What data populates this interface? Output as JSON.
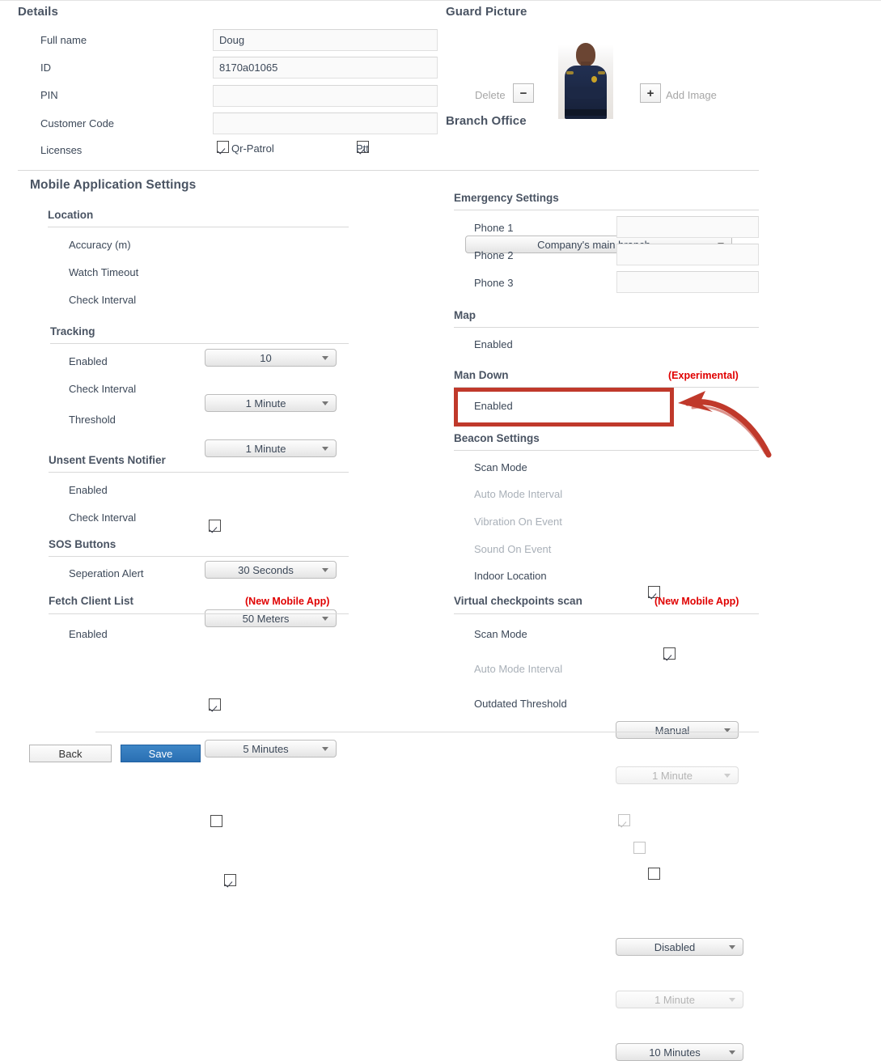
{
  "details": {
    "title": "Details",
    "fields": [
      {
        "label": "Full name",
        "value": "Doug",
        "placeholder": ""
      },
      {
        "label": "ID",
        "value": "8170a01065",
        "placeholder": ""
      },
      {
        "label": "PIN",
        "value": "",
        "placeholder": ""
      },
      {
        "label": "Customer Code",
        "value": "",
        "placeholder": ""
      }
    ],
    "licenses": {
      "label": "Licenses",
      "items": [
        {
          "label": "Qr-Patrol",
          "checked": true
        },
        {
          "label": "Ptt",
          "checked": true
        }
      ]
    }
  },
  "guard_picture": {
    "title": "Guard Picture",
    "delete_label": "Delete",
    "delete_icon": "minus-icon",
    "add_label": "Add Image",
    "add_icon": "plus-icon"
  },
  "branch_office": {
    "title": "Branch Office",
    "value": "Company's main branch"
  },
  "mobile_settings": {
    "title": "Mobile Application Settings",
    "sections": [
      {
        "name": "Location",
        "tag": "",
        "rows": [
          {
            "label": "Accuracy (m)",
            "type": "dropdown",
            "value": "10",
            "disabled": false
          },
          {
            "label": "Watch Timeout",
            "type": "dropdown",
            "value": "1 Minute",
            "disabled": false
          },
          {
            "label": "Check Interval",
            "type": "dropdown",
            "value": "1 Minute",
            "disabled": false
          }
        ]
      },
      {
        "name": "Tracking",
        "tag": "",
        "rows": [
          {
            "label": "Enabled",
            "type": "checkbox",
            "checked": true,
            "disabled": false
          },
          {
            "label": "Check Interval",
            "type": "dropdown",
            "value": "30 Seconds",
            "disabled": false
          },
          {
            "label": "Threshold",
            "type": "dropdown",
            "value": "50 Meters",
            "disabled": false
          }
        ]
      },
      {
        "name": "Unsent Events Notifier",
        "tag": "",
        "rows": [
          {
            "label": "Enabled",
            "type": "checkbox",
            "checked": true,
            "disabled": false
          },
          {
            "label": "Check Interval",
            "type": "dropdown",
            "value": "5 Minutes",
            "disabled": false
          }
        ]
      },
      {
        "name": "SOS Buttons",
        "tag": "",
        "rows": [
          {
            "label": "Seperation Alert",
            "type": "checkbox",
            "checked": false,
            "disabled": false
          }
        ]
      },
      {
        "name": "Fetch Client List",
        "tag": "(New Mobile App)",
        "rows": [
          {
            "label": "Enabled",
            "type": "checkbox",
            "checked": true,
            "disabled": false
          }
        ]
      }
    ]
  },
  "right_column": {
    "sections": [
      {
        "name": "Emergency Settings",
        "tag": "",
        "rows": [
          {
            "label": "Phone 1",
            "type": "input",
            "value": "",
            "disabled": false
          },
          {
            "label": "Phone 2",
            "type": "input",
            "value": "",
            "disabled": false
          },
          {
            "label": "Phone 3",
            "type": "input",
            "value": "",
            "disabled": false
          }
        ]
      },
      {
        "name": "Map",
        "tag": "",
        "rows": [
          {
            "label": "Enabled",
            "type": "checkbox",
            "checked": true,
            "disabled": false
          }
        ]
      },
      {
        "name": "Man Down",
        "tag": "(Experimental)",
        "rows": [
          {
            "label": "Enabled",
            "type": "checkbox",
            "checked": true,
            "disabled": false
          }
        ]
      },
      {
        "name": "Beacon Settings",
        "tag": "",
        "rows": [
          {
            "label": "Scan Mode",
            "type": "dropdown",
            "value": "Manual",
            "disabled": false
          },
          {
            "label": "Auto Mode Interval",
            "type": "dropdown",
            "value": "1 Minute",
            "disabled": true
          },
          {
            "label": "Vibration On Event",
            "type": "checkbox",
            "checked": true,
            "disabled": true
          },
          {
            "label": "Sound On Event",
            "type": "checkbox",
            "checked": false,
            "disabled": true
          },
          {
            "label": "Indoor Location",
            "type": "checkbox",
            "checked": false,
            "disabled": false
          }
        ]
      },
      {
        "name": "Virtual checkpoints scan",
        "tag": "(New Mobile App)",
        "rows": [
          {
            "label": "Scan Mode",
            "type": "dropdown",
            "value": "Disabled",
            "disabled": false
          },
          {
            "label": "Auto Mode Interval",
            "type": "dropdown",
            "value": "1 Minute",
            "disabled": true
          },
          {
            "label": "Outdated Threshold",
            "type": "dropdown",
            "value": "10 Minutes",
            "disabled": false
          }
        ]
      }
    ]
  },
  "annotation": {
    "highlight_color": "#c0392b",
    "arrow_color": "#c0392b",
    "target": "Man Down Enabled"
  },
  "footer": {
    "back_label": "Back",
    "save_label": "Save"
  }
}
